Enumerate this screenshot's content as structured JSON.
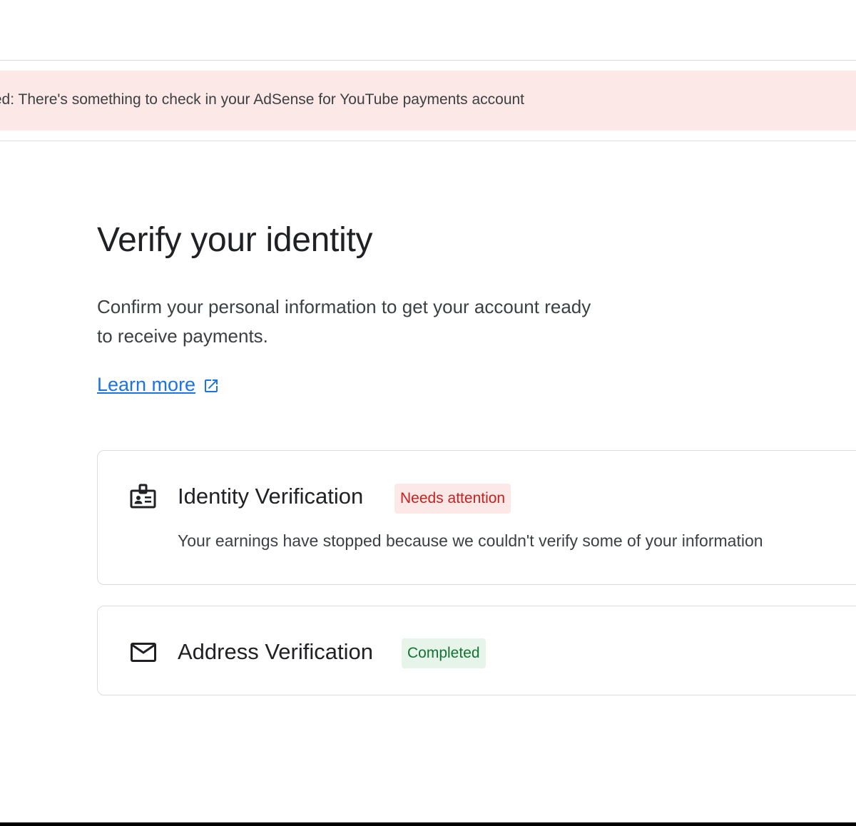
{
  "alert": {
    "text": "on required: There's something to check in your AdSense for YouTube payments account",
    "color": "#fce8e6"
  },
  "main": {
    "title": "Verify your identity",
    "intro": "Confirm your personal information to get your account ready to receive payments.",
    "learn_more": "Learn more",
    "learn_more_icon": "open-in-new-icon",
    "link_color": "#1a73e8"
  },
  "cards": [
    {
      "icon": "id-badge-icon",
      "title": "Identity Verification",
      "status": "Needs attention",
      "status_color": "#c5221f",
      "status_bg": "#fce8e6",
      "description": "Your earnings have stopped because we couldn't verify some of your information"
    },
    {
      "icon": "mail-icon",
      "title": "Address Verification",
      "status": "Completed",
      "status_color": "#137333",
      "status_bg": "#e6f4ea"
    }
  ]
}
